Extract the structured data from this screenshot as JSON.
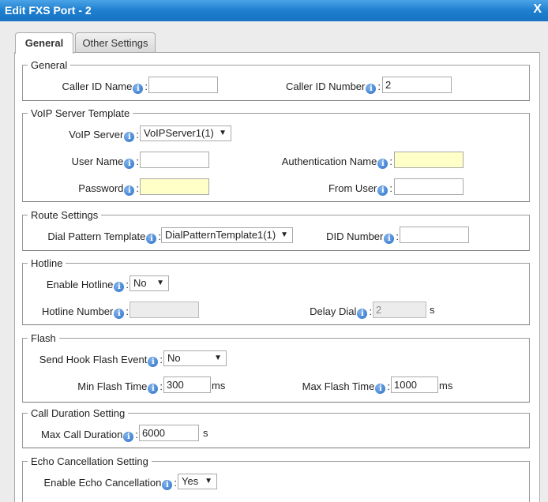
{
  "dialog": {
    "title": "Edit FXS Port - 2",
    "close": "X"
  },
  "tabs": {
    "general": "General",
    "other": "Other Settings"
  },
  "general": {
    "legend": "General",
    "caller_id_name_label": "Caller ID Name",
    "caller_id_name_value": "",
    "caller_id_number_label": "Caller ID Number",
    "caller_id_number_value": "2"
  },
  "voip": {
    "legend": "VoIP Server Template",
    "server_label": "VoIP Server",
    "server_value": "VoIPServer1(1)",
    "user_name_label": "User Name",
    "user_name_value": "",
    "auth_name_label": "Authentication Name",
    "auth_name_value": "",
    "password_label": "Password",
    "password_value": "",
    "from_user_label": "From User",
    "from_user_value": ""
  },
  "route": {
    "legend": "Route Settings",
    "dial_pattern_label": "Dial Pattern Template",
    "dial_pattern_value": "DialPatternTemplate1(1)",
    "did_label": "DID Number",
    "did_value": ""
  },
  "hotline": {
    "legend": "Hotline",
    "enable_label": "Enable Hotline",
    "enable_value": "No",
    "number_label": "Hotline Number",
    "number_value": "",
    "delay_label": "Delay Dial",
    "delay_value": "2",
    "delay_unit": "s"
  },
  "flash": {
    "legend": "Flash",
    "event_label": "Send Hook Flash Event",
    "event_value": "No",
    "min_label": "Min Flash Time",
    "min_value": "300",
    "min_unit": "ms",
    "max_label": "Max Flash Time",
    "max_value": "1000",
    "max_unit": "ms"
  },
  "duration": {
    "legend": "Call Duration Setting",
    "max_label": "Max Call Duration",
    "max_value": "6000",
    "max_unit": "s"
  },
  "echo": {
    "legend": "Echo Cancellation Setting",
    "enable_label": "Enable Echo Cancellation",
    "enable_value": "Yes"
  },
  "icons": {
    "info": "info-icon",
    "dropdown": "dropdown-arrow-icon"
  }
}
